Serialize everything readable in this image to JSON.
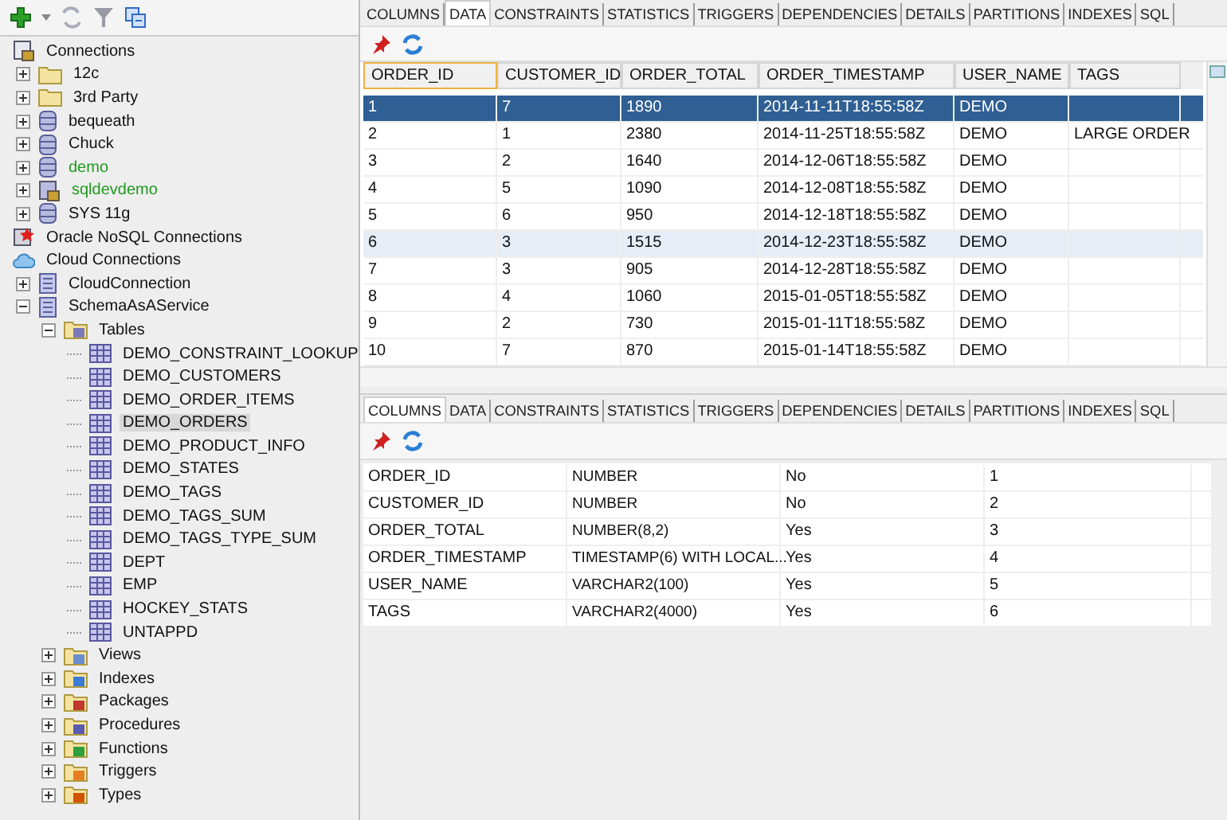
{
  "tree": [
    {
      "label": "Connections",
      "kind": "connections",
      "children": [
        {
          "label": "12c",
          "kind": "folder",
          "expanded": false
        },
        {
          "label": "3rd Party",
          "kind": "folder",
          "expanded": false
        },
        {
          "label": "bequeath",
          "kind": "database",
          "expanded": false,
          "connected": false
        },
        {
          "label": "Chuck",
          "kind": "database",
          "expanded": false,
          "connected": false
        },
        {
          "label": "demo",
          "kind": "database",
          "expanded": false,
          "connected": true
        },
        {
          "label": "sqldevdemo",
          "kind": "connection",
          "expanded": false,
          "connected": true
        },
        {
          "label": "SYS 11g",
          "kind": "database",
          "expanded": false,
          "connected": false
        }
      ]
    },
    {
      "label": "Oracle NoSQL Connections",
      "kind": "nosql"
    },
    {
      "label": "Cloud Connections",
      "kind": "cloud",
      "children": [
        {
          "label": "CloudConnection",
          "kind": "schema",
          "expanded": false
        },
        {
          "label": "SchemaAsAService",
          "kind": "schema",
          "expanded": true,
          "children": [
            {
              "label": "Tables",
              "kind": "tables",
              "expanded": true,
              "children": [
                {
                  "label": "DEMO_CONSTRAINT_LOOKUP",
                  "kind": "table",
                  "selected": false
                },
                {
                  "label": "DEMO_CUSTOMERS",
                  "kind": "table",
                  "selected": false
                },
                {
                  "label": "DEMO_ORDER_ITEMS",
                  "kind": "table",
                  "selected": false
                },
                {
                  "label": "DEMO_ORDERS",
                  "kind": "table",
                  "selected": true
                },
                {
                  "label": "DEMO_PRODUCT_INFO",
                  "kind": "table",
                  "selected": false
                },
                {
                  "label": "DEMO_STATES",
                  "kind": "table",
                  "selected": false
                },
                {
                  "label": "DEMO_TAGS",
                  "kind": "table",
                  "selected": false
                },
                {
                  "label": "DEMO_TAGS_SUM",
                  "kind": "table",
                  "selected": false
                },
                {
                  "label": "DEMO_TAGS_TYPE_SUM",
                  "kind": "table",
                  "selected": false
                },
                {
                  "label": "DEPT",
                  "kind": "table",
                  "selected": false
                },
                {
                  "label": "EMP",
                  "kind": "table",
                  "selected": false
                },
                {
                  "label": "HOCKEY_STATS",
                  "kind": "table",
                  "selected": false
                },
                {
                  "label": "UNTAPPD",
                  "kind": "table",
                  "selected": false
                }
              ]
            },
            {
              "label": "Views",
              "kind": "views",
              "expanded": false
            },
            {
              "label": "Indexes",
              "kind": "indexes",
              "expanded": false
            },
            {
              "label": "Packages",
              "kind": "packages",
              "expanded": false
            },
            {
              "label": "Procedures",
              "kind": "procedures",
              "expanded": false
            },
            {
              "label": "Functions",
              "kind": "functions",
              "expanded": false
            },
            {
              "label": "Triggers",
              "kind": "triggers",
              "expanded": false
            },
            {
              "label": "Types",
              "kind": "types",
              "expanded": false
            }
          ]
        }
      ]
    }
  ],
  "top_tabs": [
    {
      "label": "COLUMNS",
      "selected": false
    },
    {
      "label": "DATA",
      "selected": true
    },
    {
      "label": "CONSTRAINTS",
      "selected": false
    },
    {
      "label": "STATISTICS",
      "selected": false
    },
    {
      "label": "TRIGGERS",
      "selected": false
    },
    {
      "label": "DEPENDENCIES",
      "selected": false
    },
    {
      "label": "DETAILS",
      "selected": false
    },
    {
      "label": "PARTITIONS",
      "selected": false
    },
    {
      "label": "INDEXES",
      "selected": false
    },
    {
      "label": "SQL",
      "selected": false
    }
  ],
  "data_grid": {
    "columns": [
      {
        "label": "ORDER_ID",
        "focused": true
      },
      {
        "label": "CUSTOMER_ID",
        "focused": false
      },
      {
        "label": "ORDER_TOTAL",
        "focused": false
      },
      {
        "label": "ORDER_TIMESTAMP",
        "focused": false
      },
      {
        "label": "USER_NAME",
        "focused": false
      },
      {
        "label": "TAGS",
        "focused": false
      }
    ],
    "rows": [
      {
        "cells": [
          "1",
          "7",
          "1890",
          "2014-11-11T18:55:58Z",
          "DEMO",
          ""
        ],
        "selected": true,
        "hovered": false
      },
      {
        "cells": [
          "2",
          "1",
          "2380",
          "2014-11-25T18:55:58Z",
          "DEMO",
          "LARGE ORDER"
        ],
        "selected": false,
        "hovered": false
      },
      {
        "cells": [
          "3",
          "2",
          "1640",
          "2014-12-06T18:55:58Z",
          "DEMO",
          ""
        ],
        "selected": false,
        "hovered": false
      },
      {
        "cells": [
          "4",
          "5",
          "1090",
          "2014-12-08T18:55:58Z",
          "DEMO",
          ""
        ],
        "selected": false,
        "hovered": false
      },
      {
        "cells": [
          "5",
          "6",
          "950",
          "2014-12-18T18:55:58Z",
          "DEMO",
          ""
        ],
        "selected": false,
        "hovered": false
      },
      {
        "cells": [
          "6",
          "3",
          "1515",
          "2014-12-23T18:55:58Z",
          "DEMO",
          ""
        ],
        "selected": false,
        "hovered": true
      },
      {
        "cells": [
          "7",
          "3",
          "905",
          "2014-12-28T18:55:58Z",
          "DEMO",
          ""
        ],
        "selected": false,
        "hovered": false
      },
      {
        "cells": [
          "8",
          "4",
          "1060",
          "2015-01-05T18:55:58Z",
          "DEMO",
          ""
        ],
        "selected": false,
        "hovered": false
      },
      {
        "cells": [
          "9",
          "2",
          "730",
          "2015-01-11T18:55:58Z",
          "DEMO",
          ""
        ],
        "selected": false,
        "hovered": false
      },
      {
        "cells": [
          "10",
          "7",
          "870",
          "2015-01-14T18:55:58Z",
          "DEMO",
          ""
        ],
        "selected": false,
        "hovered": false
      }
    ]
  },
  "bottom_tabs": [
    {
      "label": "COLUMNS",
      "selected": true
    },
    {
      "label": "DATA",
      "selected": false
    },
    {
      "label": "CONSTRAINTS",
      "selected": false
    },
    {
      "label": "STATISTICS",
      "selected": false
    },
    {
      "label": "TRIGGERS",
      "selected": false
    },
    {
      "label": "DEPENDENCIES",
      "selected": false
    },
    {
      "label": "DETAILS",
      "selected": false
    },
    {
      "label": "PARTITIONS",
      "selected": false
    },
    {
      "label": "INDEXES",
      "selected": false
    },
    {
      "label": "SQL",
      "selected": false
    }
  ],
  "columns_grid": {
    "rows": [
      {
        "cells": [
          "ORDER_ID",
          "NUMBER",
          "No",
          "1"
        ]
      },
      {
        "cells": [
          "CUSTOMER_ID",
          "NUMBER",
          "No",
          "2"
        ]
      },
      {
        "cells": [
          "ORDER_TOTAL",
          "NUMBER(8,2)",
          "Yes",
          "3"
        ]
      },
      {
        "cells": [
          "ORDER_TIMESTAMP",
          "TIMESTAMP(6) WITH LOCAL...",
          "Yes",
          "4"
        ]
      },
      {
        "cells": [
          "USER_NAME",
          "VARCHAR2(100)",
          "Yes",
          "5"
        ]
      },
      {
        "cells": [
          "TAGS",
          "VARCHAR2(4000)",
          "Yes",
          "6"
        ]
      }
    ]
  }
}
